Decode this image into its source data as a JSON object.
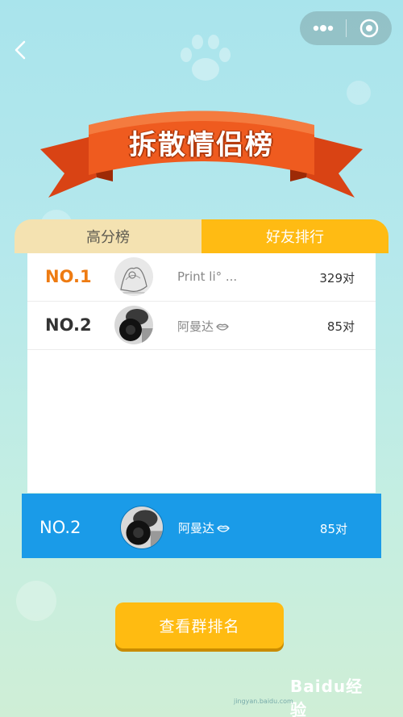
{
  "nav": {
    "back_icon": "chevron-left-icon",
    "more_icon": "more-dots-icon",
    "close_icon": "target-close-icon"
  },
  "header": {
    "title": "拆散情侣榜"
  },
  "tabs": [
    {
      "label": "高分榜",
      "active": false
    },
    {
      "label": "好友排行",
      "active": true
    }
  ],
  "ranking": [
    {
      "rank": "NO.1",
      "name": "Print li° ...",
      "score": "329对",
      "highlight": true
    },
    {
      "rank": "NO.2",
      "name": "阿曼达",
      "score": "85对",
      "highlight": false
    }
  ],
  "my_rank": {
    "rank": "NO.2",
    "name": "阿曼达",
    "score": "85对"
  },
  "actions": {
    "group_ranking_label": "查看群排名"
  },
  "watermark": {
    "logo": "Baidu经验",
    "url": "jingyan.baidu.com"
  },
  "colors": {
    "tab_active": "#ffbb13",
    "tab_inactive": "#f4e2b1",
    "first_place": "#ee7b12",
    "my_rank_bar": "#1a9be8",
    "button": "#ffbb11",
    "ribbon": "#e8531c"
  }
}
